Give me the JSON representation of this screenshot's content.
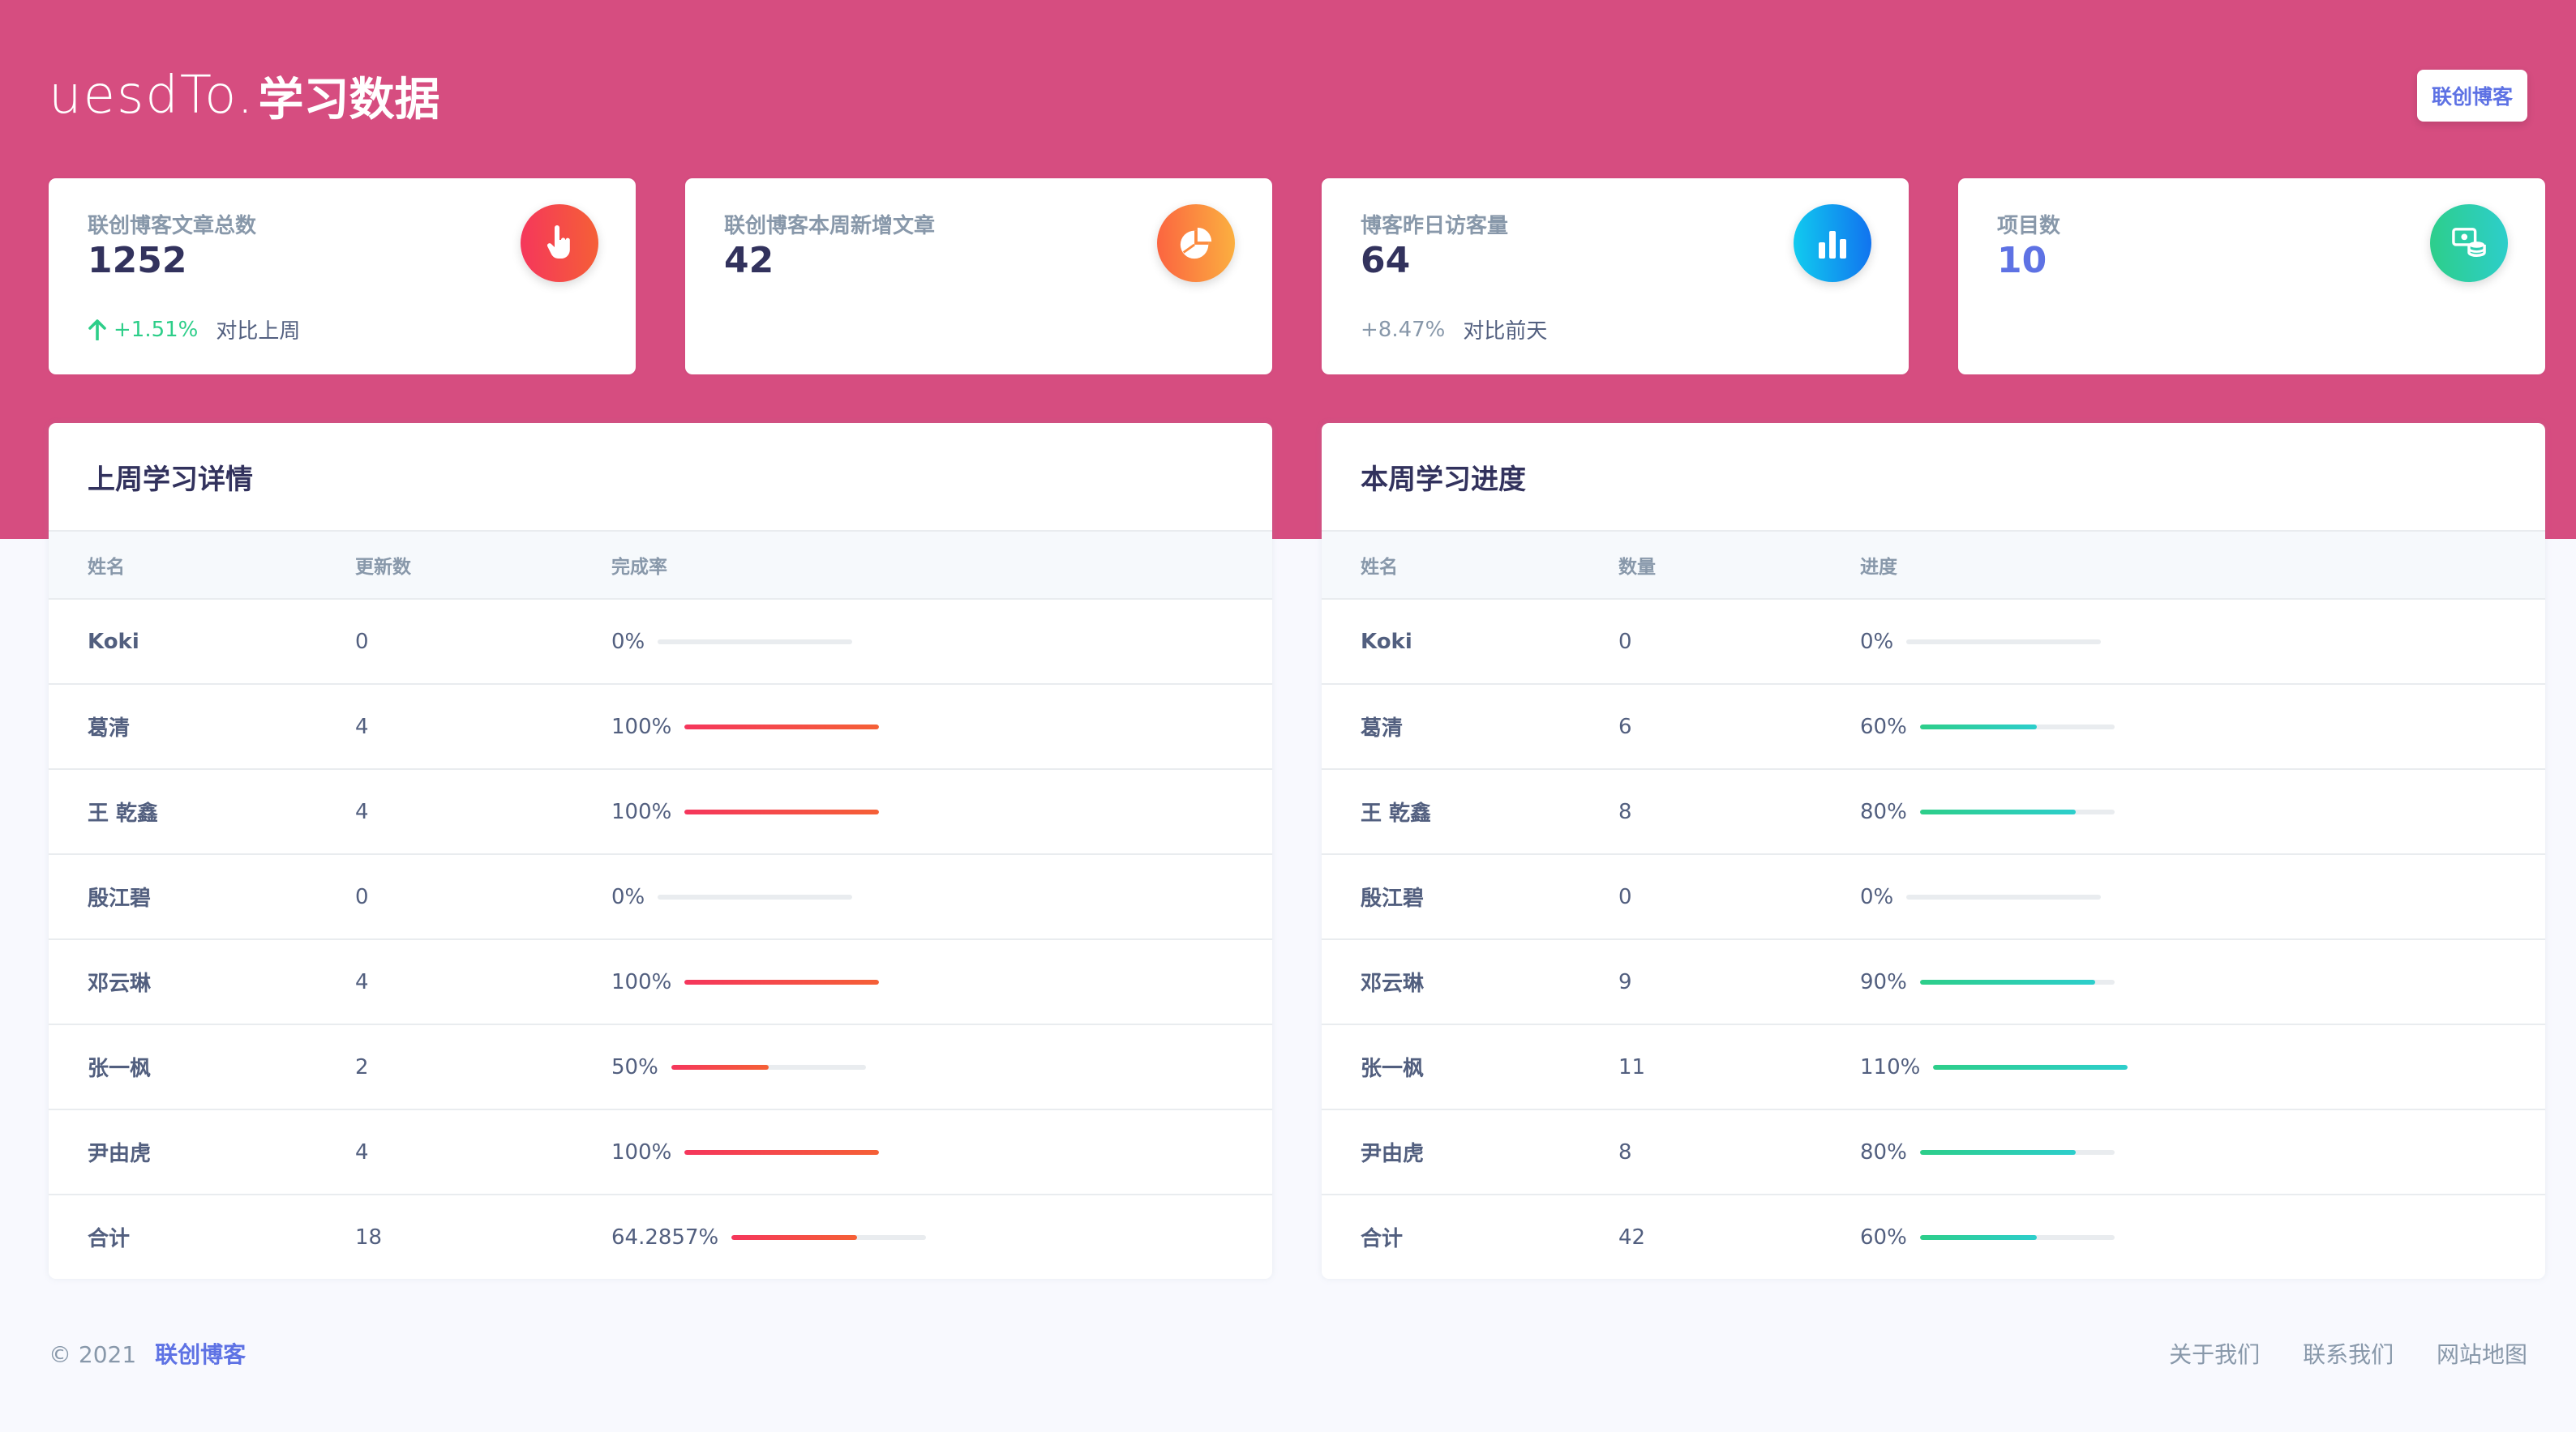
{
  "colors": {
    "hero": "#d64d80",
    "accent": "#5e72e4",
    "success": "#2dce89",
    "danger_bar": "#f5365c",
    "teal_bar": "#2dcecc"
  },
  "header": {
    "logo_text": "uesdTo.",
    "title": "学习数据",
    "button_label": "联创博客"
  },
  "stats": [
    {
      "label": "联创博客文章总数",
      "value": "1252",
      "icon": "hand-pointer-icon",
      "change": "+1.51%",
      "note": "对比上周",
      "trend": "up"
    },
    {
      "label": "联创博客本周新增文章",
      "value": "42",
      "icon": "pie-chart-icon",
      "change": "",
      "note": "",
      "trend": ""
    },
    {
      "label": "博客昨日访客量",
      "value": "64",
      "icon": "bar-chart-icon",
      "change": "+8.47%",
      "note": "对比前天",
      "trend": "neutral"
    },
    {
      "label": "项目数",
      "value": "10",
      "icon": "money-coins-icon",
      "change": "",
      "note": "",
      "trend": ""
    }
  ],
  "last_week": {
    "title": "上周学习详情",
    "columns": [
      "姓名",
      "更新数",
      "完成率"
    ],
    "rows": [
      {
        "name": "Koki",
        "count": "0",
        "rate": "0%",
        "progress": 0
      },
      {
        "name": "葛清",
        "count": "4",
        "rate": "100%",
        "progress": 1
      },
      {
        "name": "王 乾鑫",
        "count": "4",
        "rate": "100%",
        "progress": 1
      },
      {
        "name": "殷江碧",
        "count": "0",
        "rate": "0%",
        "progress": 0
      },
      {
        "name": "邓云琳",
        "count": "4",
        "rate": "100%",
        "progress": 1
      },
      {
        "name": "张一枫",
        "count": "2",
        "rate": "50%",
        "progress": 0.5
      },
      {
        "name": "尹由虎",
        "count": "4",
        "rate": "100%",
        "progress": 1
      },
      {
        "name": "合计",
        "count": "18",
        "rate": "64.2857%",
        "progress": 0.642857
      }
    ]
  },
  "this_week": {
    "title": "本周学习进度",
    "columns": [
      "姓名",
      "数量",
      "进度"
    ],
    "rows": [
      {
        "name": "Koki",
        "count": "0",
        "rate": "0%",
        "progress": 0
      },
      {
        "name": "葛清",
        "count": "6",
        "rate": "60%",
        "progress": 0.6
      },
      {
        "name": "王 乾鑫",
        "count": "8",
        "rate": "80%",
        "progress": 0.8
      },
      {
        "name": "殷江碧",
        "count": "0",
        "rate": "0%",
        "progress": 0
      },
      {
        "name": "邓云琳",
        "count": "9",
        "rate": "90%",
        "progress": 0.9
      },
      {
        "name": "张一枫",
        "count": "11",
        "rate": "110%",
        "progress": 1.1
      },
      {
        "name": "尹由虎",
        "count": "8",
        "rate": "80%",
        "progress": 0.8
      },
      {
        "name": "合计",
        "count": "42",
        "rate": "60%",
        "progress": 0.6
      }
    ]
  },
  "footer": {
    "copyright": "© 2021",
    "brand_link": "联创博客",
    "links": [
      "关于我们",
      "联系我们",
      "网站地图"
    ]
  }
}
